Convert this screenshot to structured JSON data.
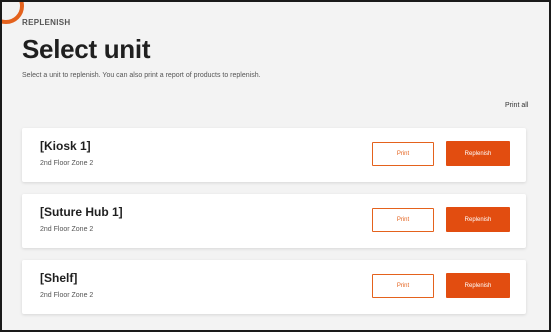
{
  "header": {
    "eyebrow": "REPLENISH",
    "title": "Select unit",
    "subtitle": "Select a unit to replenish. You can also print a report of products to replenish.",
    "print_all_label": "Print all"
  },
  "units": [
    {
      "name": "[Kiosk 1]",
      "location": "2nd Floor  Zone 2",
      "print_label": "Print",
      "replenish_label": "Replenish"
    },
    {
      "name": "[Suture Hub 1]",
      "location": "2nd Floor  Zone 2",
      "print_label": "Print",
      "replenish_label": "Replenish"
    },
    {
      "name": "[Shelf]",
      "location": "2nd Floor  Zone 2",
      "print_label": "Print",
      "replenish_label": "Replenish"
    }
  ],
  "colors": {
    "accent": "#e24d10",
    "page_background": "#f3f3f3",
    "card_background": "#ffffff"
  },
  "icons": {
    "cursor": "mouse-pointer-icon",
    "corner_accent": "orange-ring"
  }
}
